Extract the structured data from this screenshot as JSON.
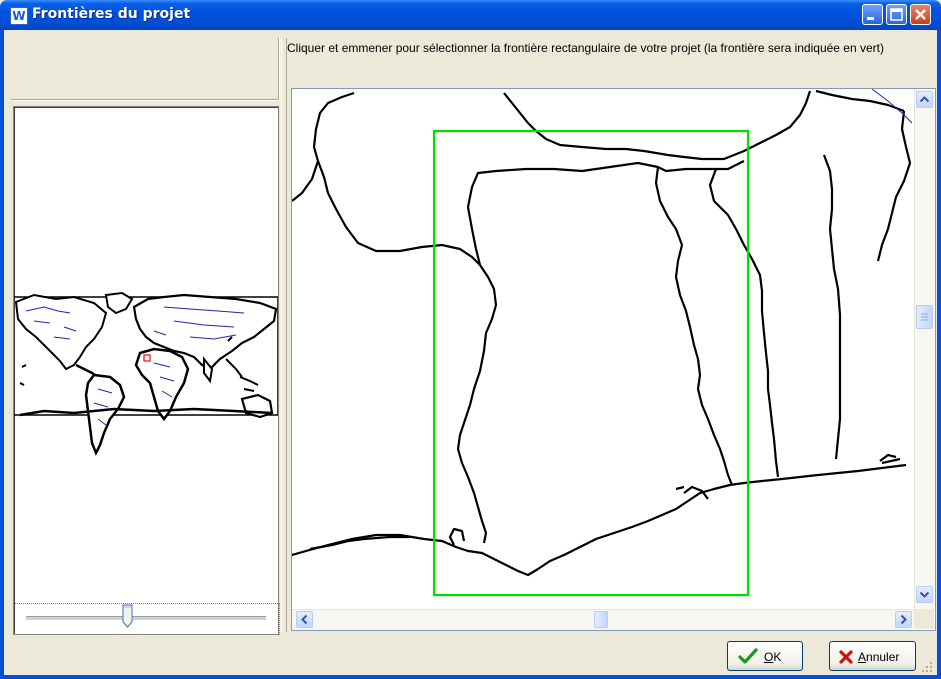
{
  "window": {
    "title": "Frontières du projet",
    "app_icon_letter": "W"
  },
  "instruction": "Cliquer et emmener pour sélectionner la frontière rectangulaire de votre projet (la frontière sera indiquée en vert)",
  "zoom_slider": {
    "value_fraction": 0.42
  },
  "buttons": {
    "ok": {
      "label_accel": "O",
      "label_rest": "K"
    },
    "cancel": {
      "label_accel": "A",
      "label_rest": "nnuler"
    }
  },
  "colors": {
    "selection": "#00E000",
    "minimap_marker": "#FF0000",
    "titlebar": "#0053E0"
  }
}
